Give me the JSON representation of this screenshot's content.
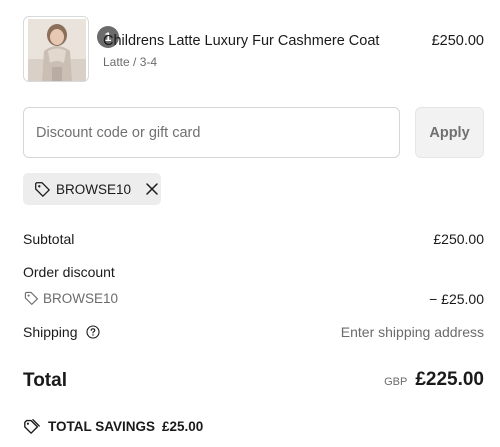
{
  "line_item": {
    "quantity": "1",
    "title": "Childrens Latte Luxury Fur Cashmere Coat",
    "variant": "Latte / 3-4",
    "price": "£250.00"
  },
  "discount": {
    "placeholder": "Discount code or gift card",
    "value": "",
    "apply_label": "Apply",
    "applied_code": "BROWSE10"
  },
  "summary": {
    "subtotal_label": "Subtotal",
    "subtotal_value": "£250.00",
    "order_discount_label": "Order discount",
    "order_discount_code": "BROWSE10",
    "order_discount_value": "− £25.00",
    "shipping_label": "Shipping",
    "shipping_value": "Enter shipping address",
    "total_label": "Total",
    "total_currency": "GBP",
    "total_value": "£225.00",
    "savings_label": "TOTAL SAVINGS",
    "savings_value": "£25.00"
  },
  "icons": {
    "tag": "tag-icon",
    "remove": "close-icon",
    "help": "question-circle-icon",
    "savings": "double-tag-icon"
  },
  "colors": {
    "text": "#1a1a1a",
    "muted": "#6b6b6b",
    "chip_bg": "#ededed",
    "badge_bg": "#6b6b6b"
  }
}
